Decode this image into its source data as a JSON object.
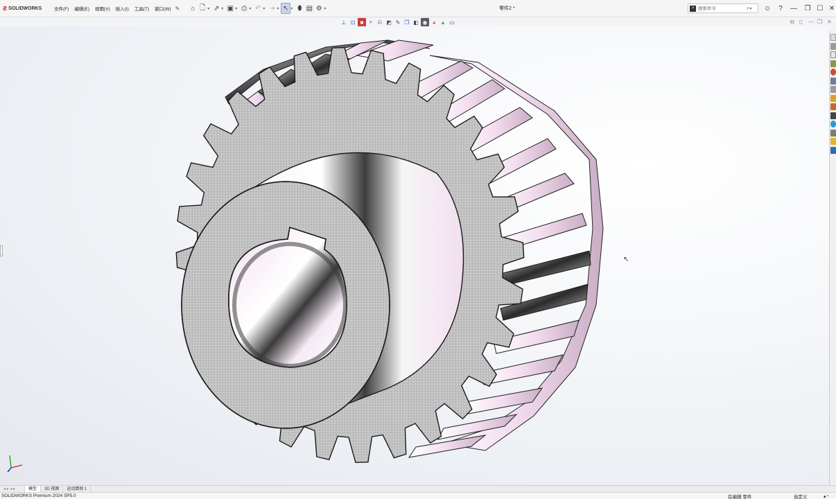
{
  "app": {
    "logo_text": "SOLIDWORKS",
    "document_title": "零件2 *"
  },
  "menu": [
    {
      "label": "文件(F)"
    },
    {
      "label": "编辑(E)"
    },
    {
      "label": "视图(V)"
    },
    {
      "label": "插入(I)"
    },
    {
      "label": "工具(T)"
    },
    {
      "label": "窗口(W)"
    }
  ],
  "search": {
    "placeholder": "搜索命令"
  },
  "bottom_tabs": [
    {
      "label": "模型"
    },
    {
      "label": "3D 视图"
    },
    {
      "label": "运动算例 1"
    }
  ],
  "status": {
    "product": "SOLIDWORKS Premium 2024 SP5.0",
    "editing": "在编辑 零件",
    "units": "自定义"
  },
  "icons": {
    "toolbar": [
      "home-icon",
      "new-icon",
      "open-icon",
      "save-icon",
      "print-icon",
      "undo-icon",
      "redo-icon",
      "select-icon",
      "rebuild-icon",
      "file-properties-icon",
      "options-icon"
    ],
    "window": [
      "help-options-icon",
      "help-icon",
      "minimize-icon",
      "restore-icon",
      "maximize-icon",
      "close-icon"
    ],
    "heads_up": [
      "view-orientation-icon",
      "zoom-to-fit-icon",
      "section-view-icon",
      "zoom-area-icon",
      "previous-view-icon",
      "section-icon",
      "dynamic-annotation-icon",
      "view-orientation-cube-icon",
      "display-style-icon",
      "hide-show-icon",
      "appearance-icon",
      "scene-icon",
      "display-settings-icon"
    ],
    "task_pane": [
      "solidworks-resources-icon",
      "design-library-icon",
      "file-explorer-icon",
      "view-palette-icon",
      "appearances-icon",
      "custom-properties-icon",
      "3dexperience-icon",
      "toolbox-icon",
      "solidworks-forum-icon",
      "markup-icon",
      "mysolidworks-icon",
      "community-icon",
      "cad-apps-icon",
      "3d-content-icon"
    ]
  },
  "colors": {
    "brand_red": "#d7151a",
    "gear_metal": "#c6c6c6",
    "gear_face_tint": "#f2dff0",
    "viewport_background": "#eef1f5"
  }
}
